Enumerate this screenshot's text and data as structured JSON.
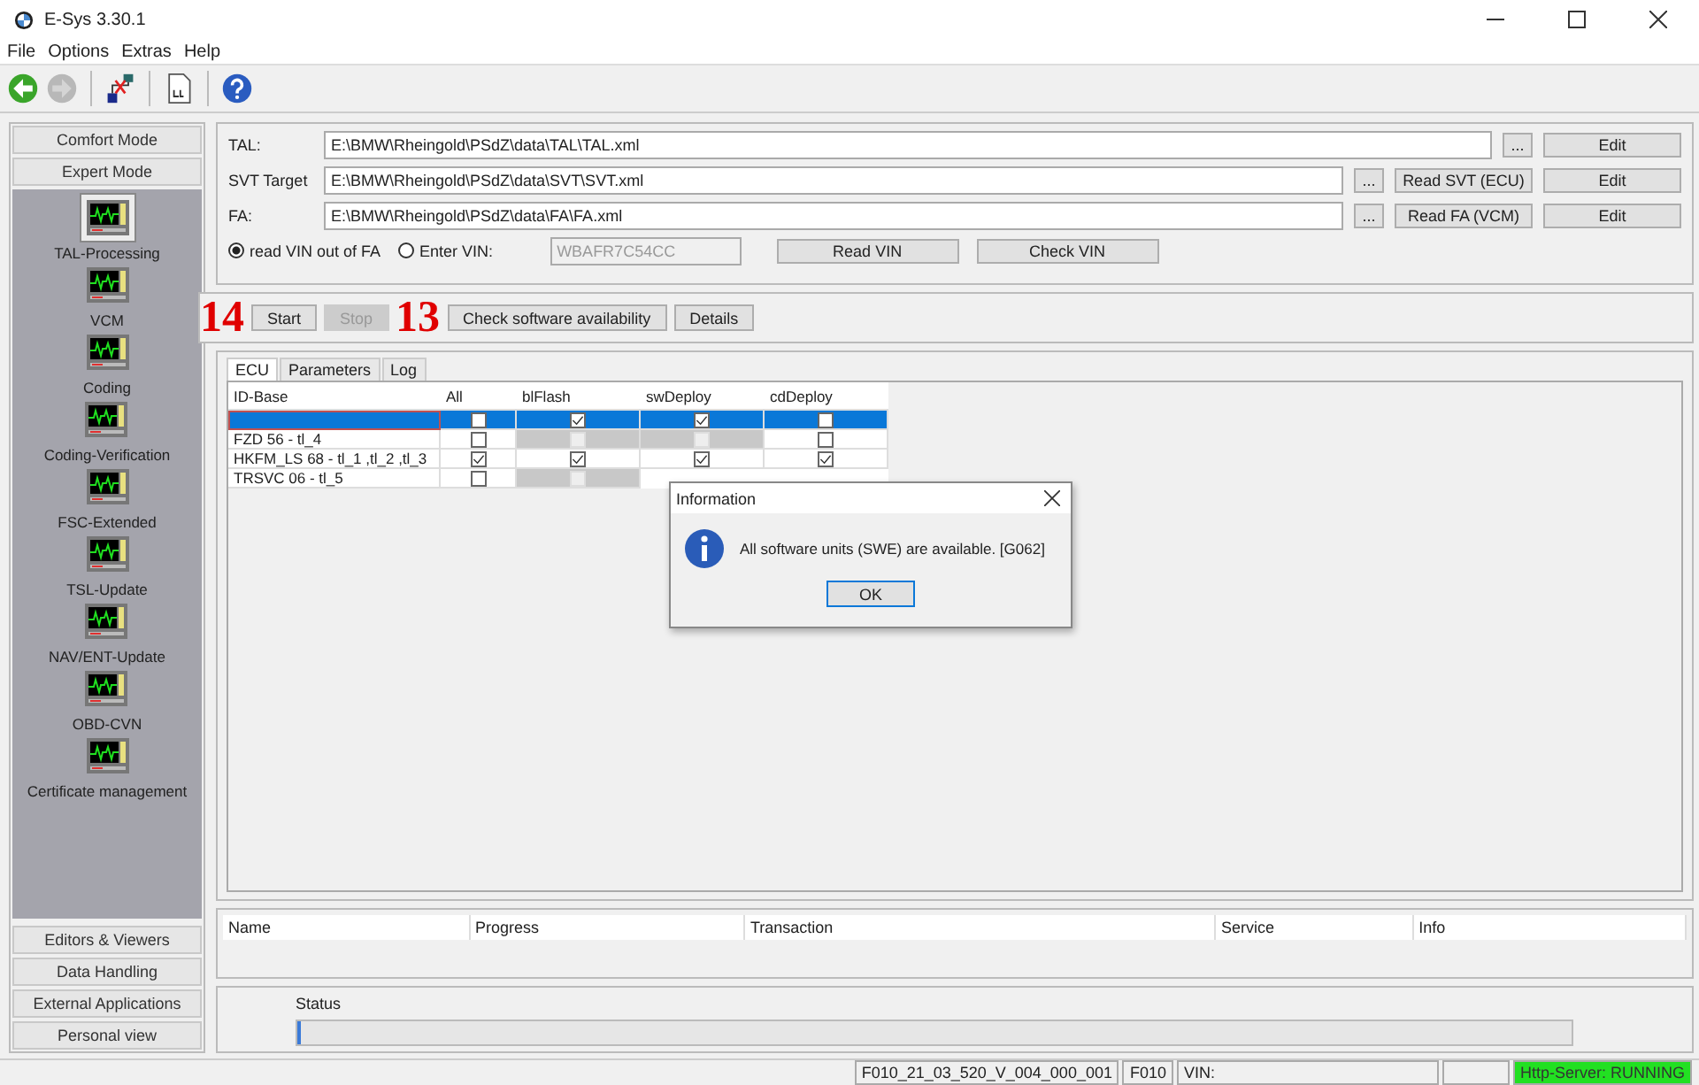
{
  "window": {
    "title": "E-Sys 3.30.1"
  },
  "menu": [
    "File",
    "Options",
    "Extras",
    "Help"
  ],
  "toolbar": [
    {
      "kind": "back",
      "disabled": false
    },
    {
      "kind": "forward",
      "disabled": true
    },
    {
      "kind": "network",
      "disabled": false
    },
    {
      "kind": "log",
      "disabled": false
    },
    {
      "kind": "help",
      "disabled": false
    }
  ],
  "sidebar": {
    "top_buttons": [
      "Comfort Mode",
      "Expert Mode"
    ],
    "items": [
      {
        "label": "TAL-Processing",
        "selected": true
      },
      {
        "label": "VCM",
        "selected": false
      },
      {
        "label": "Coding",
        "selected": false
      },
      {
        "label": "Coding-Verification",
        "selected": false
      },
      {
        "label": "FSC-Extended",
        "selected": false
      },
      {
        "label": "TSL-Update",
        "selected": false
      },
      {
        "label": "NAV/ENT-Update",
        "selected": false
      },
      {
        "label": "OBD-CVN",
        "selected": false
      },
      {
        "label": "Certificate management",
        "selected": false
      }
    ],
    "bottom_buttons": [
      "Editors & Viewers",
      "Data Handling",
      "External Applications",
      "Personal view"
    ]
  },
  "files": [
    {
      "label": "TAL:",
      "value": "E:\\BMW\\Rheingold\\PSdZ\\data\\TAL\\TAL.xml",
      "browse": "...",
      "buttons": [
        "Edit"
      ]
    },
    {
      "label": "SVT Target",
      "value": "E:\\BMW\\Rheingold\\PSdZ\\data\\SVT\\SVT.xml",
      "browse": "...",
      "buttons": [
        "Read SVT (ECU)",
        "Edit"
      ]
    },
    {
      "label": "FA:",
      "value": "E:\\BMW\\Rheingold\\PSdZ\\data\\FA\\FA.xml",
      "browse": "...",
      "buttons": [
        "Read FA (VCM)",
        "Edit"
      ]
    }
  ],
  "vin": {
    "options": [
      {
        "label": "read VIN out of FA",
        "selected": true
      },
      {
        "label": "Enter VIN:",
        "selected": false
      }
    ],
    "value": "WBAFR7C54CC",
    "value_disabled": true,
    "buttons": [
      "Read VIN",
      "Check VIN"
    ]
  },
  "actions": [
    {
      "label": "Start",
      "disabled": false,
      "step": "14"
    },
    {
      "label": "Stop",
      "disabled": true
    },
    {
      "label": "Check software availability",
      "disabled": false,
      "step": "13"
    },
    {
      "label": "Details",
      "disabled": false
    }
  ],
  "tabs": [
    {
      "label": "ECU",
      "selected": true
    },
    {
      "label": "Parameters",
      "selected": false
    },
    {
      "label": "Log",
      "selected": false
    }
  ],
  "ecu_table": {
    "columns": [
      "ID-Base",
      "All",
      "blFlash",
      "swDeploy",
      "cdDeploy"
    ],
    "rows": [
      {
        "id": "",
        "selected": true,
        "cells": [
          {
            "checked": false,
            "disabled": false
          },
          {
            "checked": true,
            "disabled": false
          },
          {
            "checked": true,
            "disabled": false
          },
          {
            "checked": false,
            "disabled": false
          }
        ]
      },
      {
        "id": "FZD 56 - tl_4",
        "selected": false,
        "cells": [
          {
            "checked": false,
            "disabled": false
          },
          {
            "checked": false,
            "disabled": true
          },
          {
            "checked": false,
            "disabled": true
          },
          {
            "checked": false,
            "disabled": false
          }
        ]
      },
      {
        "id": "HKFM_LS 68 - tl_1 ,tl_2 ,tl_3",
        "selected": false,
        "cells": [
          {
            "checked": true,
            "disabled": false
          },
          {
            "checked": true,
            "disabled": false
          },
          {
            "checked": true,
            "disabled": false
          },
          {
            "checked": true,
            "disabled": false
          }
        ]
      },
      {
        "id": "TRSVC 06 - tl_5",
        "selected": false,
        "cells": [
          {
            "checked": false,
            "disabled": false
          },
          {
            "checked": false,
            "disabled": true
          }
        ]
      }
    ]
  },
  "dialog": {
    "title": "Information",
    "message": "All software units (SWE) are available. [G062]",
    "button": "OK"
  },
  "job_table": {
    "columns": [
      "Name",
      "Progress",
      "Transaction",
      "Service",
      "Info"
    ]
  },
  "status": {
    "label": "Status",
    "level": 0
  },
  "status_bar": [
    {
      "text": "F010_21_03_520_V_004_000_001",
      "kind": "plain"
    },
    {
      "text": "F010",
      "kind": "plain"
    },
    {
      "text": "VIN:",
      "kind": "wide"
    },
    {
      "kind": "blank"
    },
    {
      "text": "Http-Server: RUNNING",
      "kind": "ok"
    }
  ]
}
